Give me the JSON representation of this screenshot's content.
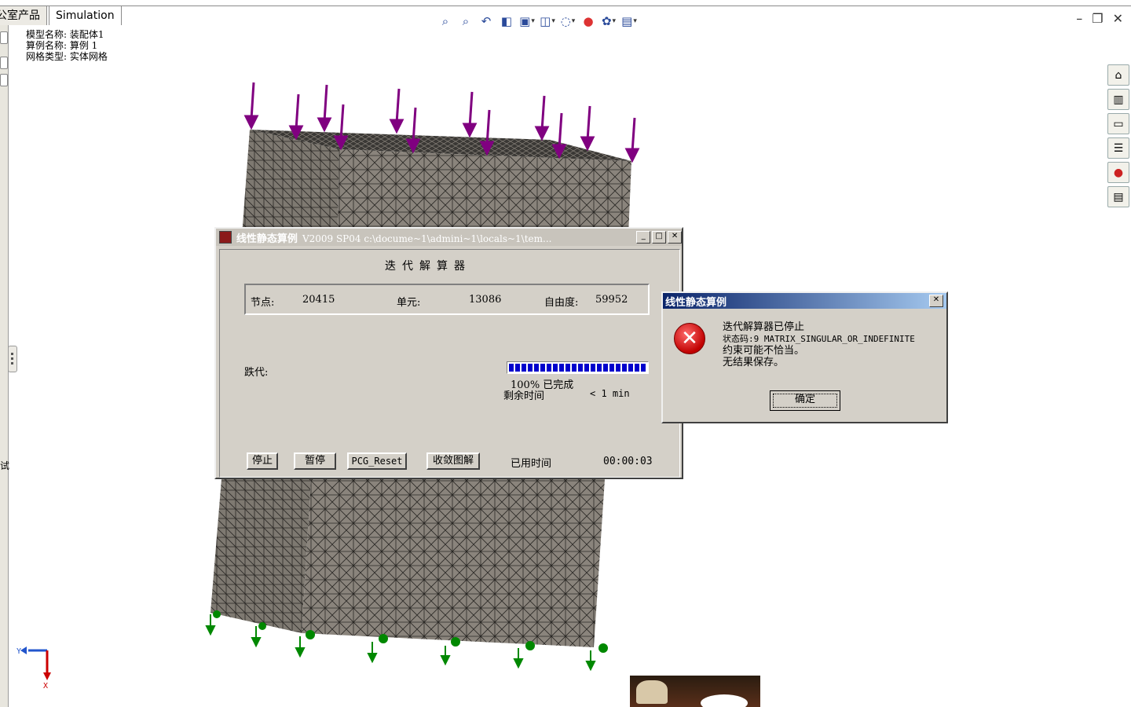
{
  "tabs": [
    "公室产品",
    "Simulation"
  ],
  "model_info": {
    "model_name": "模型名称: 装配体1",
    "study_name": "算例名称: 算例 1",
    "mesh_type": "网格类型: 实体网格"
  },
  "view_toolbar_icons": [
    "zoom-to-fit-icon",
    "zoom-area-icon",
    "previous-view-icon",
    "section-view-icon",
    "view-orientation-icon",
    "display-style-icon",
    "hide-show-icon",
    "appearance-icon",
    "scene-icon",
    "view-settings-icon"
  ],
  "task_pane_icons": [
    "home-icon",
    "design-library-icon",
    "file-explorer-icon",
    "view-palette-icon",
    "appearance-scenes-icon",
    "custom-properties-icon"
  ],
  "solver_window": {
    "title_bold": "线性静态算例",
    "title_rest": "V2009 SP04 c:\\docume~1\\admini~1\\locals~1\\tem...",
    "heading": "迭代解算器",
    "nodes_label": "节点:",
    "nodes_value": "20415",
    "elements_label": "单元:",
    "elements_value": "13086",
    "dof_label": "自由度:",
    "dof_value": "59952",
    "iteration_label": "跌代:",
    "progress_fraction": 1.0,
    "percent_text": "100% 已完成",
    "remaining_label": "剩余时间",
    "remaining_value": "< 1 min",
    "btn_stop": "停止",
    "btn_pause": "暂停",
    "btn_pcg_reset": "PCG_Reset",
    "btn_convergence": "收敛图解",
    "elapsed_label": "已用时间",
    "elapsed_value": "00:00:03"
  },
  "error_dialog": {
    "title": "线性静态算例",
    "line1": "迭代解算器已停止",
    "line2": "状态码:9 MATRIX_SINGULAR_OR_INDEFINITE",
    "line3": "约束可能不恰当。",
    "line4": "无结果保存。",
    "ok_label": "确定"
  },
  "triad": {
    "y_label": "Y",
    "x_label": "X"
  },
  "left_edge_char": "试",
  "colors": {
    "load_arrow": "#800080",
    "fixture": "#008800",
    "mesh_face": "#8a847c",
    "mesh_top": "#5a5650"
  }
}
